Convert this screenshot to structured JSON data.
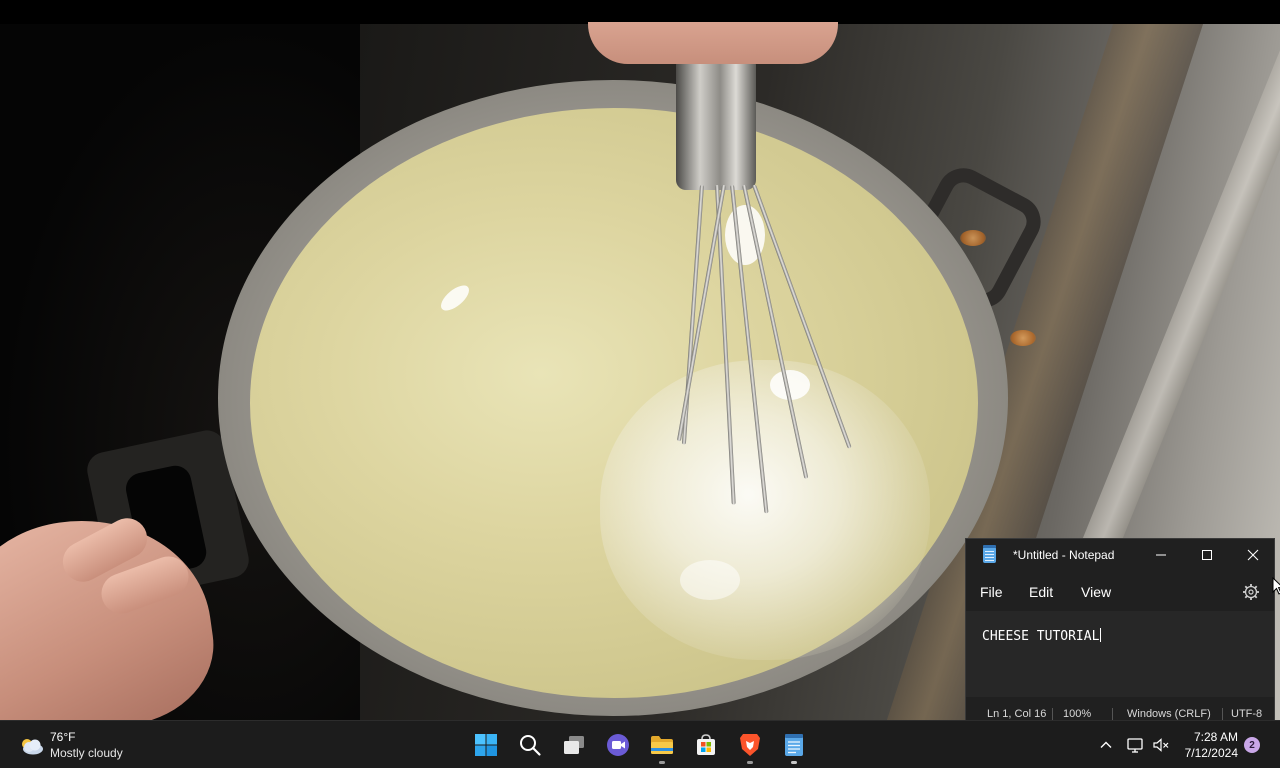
{
  "notepad": {
    "title": "*Untitled - Notepad",
    "menu": {
      "file": "File",
      "edit": "Edit",
      "view": "View"
    },
    "content": "CHEESE TUTORIAL",
    "status": {
      "position": "Ln 1, Col 16",
      "zoom": "100%",
      "line_ending": "Windows (CRLF)",
      "encoding": "UTF-8"
    },
    "buttons": {
      "minimize": "–",
      "maximize": "□",
      "close": "✕"
    }
  },
  "taskbar": {
    "weather": {
      "temperature": "76°F",
      "condition": "Mostly cloudy",
      "icon": "partly-cloudy-icon"
    },
    "apps": [
      {
        "name": "start",
        "icon": "windows-logo-icon"
      },
      {
        "name": "search",
        "icon": "search-icon"
      },
      {
        "name": "task-view",
        "icon": "task-view-icon"
      },
      {
        "name": "meet",
        "icon": "video-chat-icon"
      },
      {
        "name": "file-explorer",
        "icon": "folder-icon"
      },
      {
        "name": "microsoft-store",
        "icon": "store-icon"
      },
      {
        "name": "brave",
        "icon": "brave-lion-icon"
      },
      {
        "name": "notepad",
        "icon": "notepad-icon"
      }
    ],
    "tray": {
      "time": "7:28 AM",
      "date": "7/12/2024",
      "notification_count": "2"
    }
  },
  "colors": {
    "taskbar_bg": "#1c1c1c",
    "notepad_bg": "#202020",
    "editor_bg": "#272727",
    "accent_blue": "#0078d4"
  }
}
